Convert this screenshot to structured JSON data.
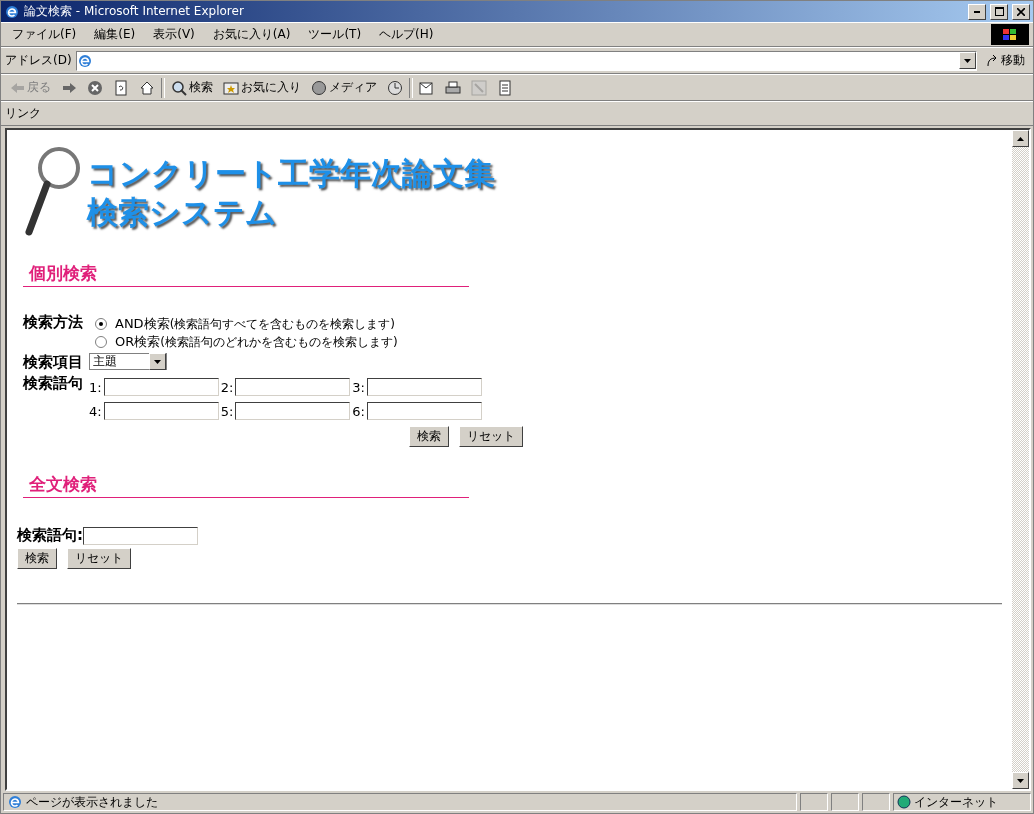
{
  "window": {
    "title": "論文検索 - Microsoft Internet Explorer"
  },
  "menu": [
    "ファイル(F)",
    "編集(E)",
    "表示(V)",
    "お気に入り(A)",
    "ツール(T)",
    "ヘルプ(H)"
  ],
  "address": {
    "label": "アドレス(D)",
    "go": "移動"
  },
  "toolbar": [
    {
      "kind": "back",
      "label": "戻る",
      "disabled": true
    },
    {
      "kind": "forward",
      "disabled": false
    },
    {
      "kind": "stop",
      "disabled": false
    },
    {
      "kind": "refresh",
      "disabled": false
    },
    {
      "kind": "home",
      "disabled": false
    },
    {
      "kind": "search",
      "label": "検索",
      "disabled": false
    },
    {
      "kind": "favorites",
      "label": "お気に入り",
      "disabled": false
    },
    {
      "kind": "media",
      "label": "メディア",
      "disabled": false
    },
    {
      "kind": "history",
      "disabled": false
    },
    {
      "kind": "mail",
      "disabled": false
    },
    {
      "kind": "print",
      "disabled": false
    },
    {
      "kind": "edit",
      "disabled": true
    },
    {
      "kind": "discuss",
      "disabled": false
    }
  ],
  "links": {
    "label": "リンク"
  },
  "page": {
    "title_lines": [
      "コンクリート工学年次論文集",
      "検索システム"
    ],
    "individual": {
      "heading": "個別検索",
      "method_label": "検索方法",
      "methods": [
        {
          "label": "AND検索",
          "note": "(検索語句すべてを含むものを検索します)",
          "selected": true
        },
        {
          "label": "OR検索",
          "note": "(検索語句のどれかを含むものを検索します)",
          "selected": false
        }
      ],
      "item_label": "検索項目",
      "item_value": "主題",
      "terms_label": "検索語句",
      "terms": [
        "1:",
        "2:",
        "3:",
        "4:",
        "5:",
        "6:"
      ],
      "buttons": [
        "検索",
        "リセット"
      ]
    },
    "fulltext": {
      "heading": "全文検索",
      "terms_label": "検索語句:",
      "buttons": [
        "検索",
        "リセット"
      ]
    }
  },
  "status_bar": {
    "text": "ページが表示されました",
    "zone": "インターネット"
  }
}
